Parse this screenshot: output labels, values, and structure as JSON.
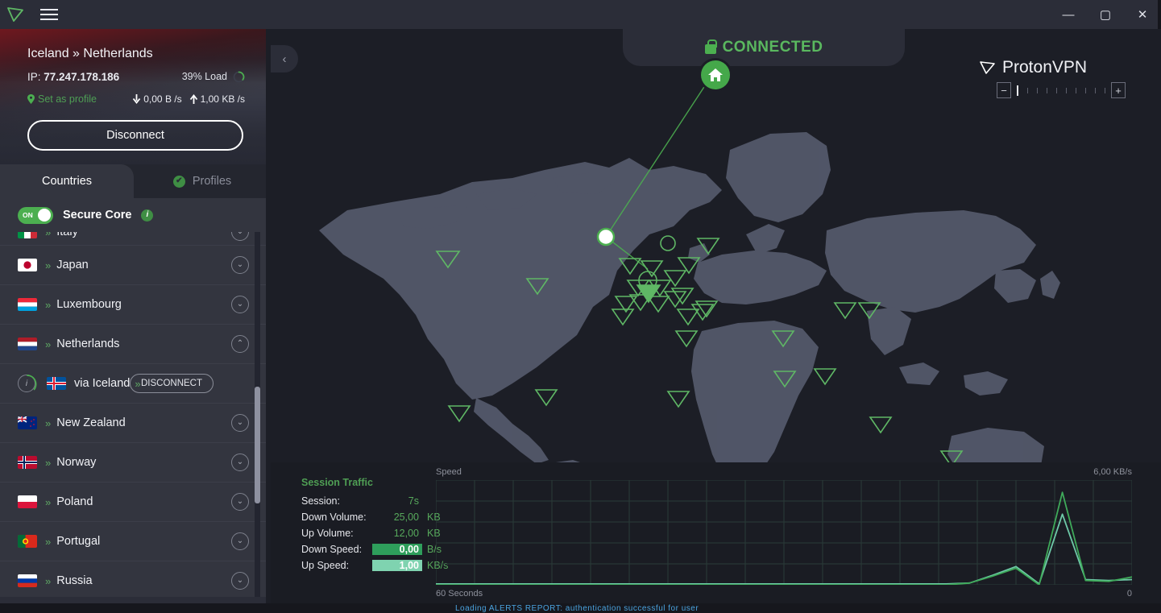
{
  "titlebar": {
    "logo_icon": "protonvpn-logo-icon",
    "menu_icon": "hamburger-menu-icon",
    "minimize": "—",
    "maximize": "▢",
    "close": "✕"
  },
  "sidebar": {
    "route": "Iceland » Netherlands",
    "ip_label": "IP:",
    "ip_value": "77.247.178.186",
    "load_text": "39% Load",
    "load_percent": 39,
    "set_as_profile": "Set as profile",
    "down_speed": "0,00 B /s",
    "up_speed": "1,00 KB /s",
    "disconnect_label": "Disconnect",
    "tabs": [
      {
        "label": "Countries",
        "active": true
      },
      {
        "label": "Profiles",
        "active": false
      }
    ],
    "secure_core": {
      "toggle_state": "ON",
      "label": "Secure Core"
    },
    "countries": [
      {
        "name": "Italy",
        "partial": true,
        "expanded": false,
        "flag": "it"
      },
      {
        "name": "Japan",
        "partial": false,
        "expanded": false,
        "flag": "jp"
      },
      {
        "name": "Luxembourg",
        "partial": false,
        "expanded": false,
        "flag": "lu"
      },
      {
        "name": "Netherlands",
        "partial": false,
        "expanded": true,
        "flag": "nl"
      },
      {
        "name": "New Zealand",
        "partial": false,
        "expanded": false,
        "flag": "nz"
      },
      {
        "name": "Norway",
        "partial": false,
        "expanded": false,
        "flag": "no"
      },
      {
        "name": "Poland",
        "partial": false,
        "expanded": false,
        "flag": "pl"
      },
      {
        "name": "Portugal",
        "partial": false,
        "expanded": false,
        "flag": "pt"
      },
      {
        "name": "Russia",
        "partial": false,
        "expanded": false,
        "flag": "ru"
      }
    ],
    "subserver": {
      "name": "via Iceland",
      "chevron": "»",
      "info": "i",
      "disconnect_label": "DISCONNECT"
    }
  },
  "map": {
    "collapse_icon": "chevron-left-icon",
    "connected_label": "CONNECTED",
    "lock_icon": "lock-icon",
    "home_icon": "home-icon",
    "brand_name": "ProtonVPN",
    "brand_icon": "protonvpn-logo-icon",
    "zoom_minus": "−",
    "zoom_plus": "+",
    "zoom_level": 1,
    "zoom_ticks": 11
  },
  "session": {
    "title": "Session Traffic",
    "rows": [
      {
        "label": "Session:",
        "value": "7s",
        "unit": "",
        "highlight": "none"
      },
      {
        "label": "Down Volume:",
        "value": "25,00",
        "unit": "KB",
        "highlight": "none"
      },
      {
        "label": "Up Volume:",
        "value": "12,00",
        "unit": "KB",
        "highlight": "none"
      },
      {
        "label": "Down Speed:",
        "value": "0,00",
        "unit": "B/s",
        "highlight": "dark"
      },
      {
        "label": "Up Speed:",
        "value": "1,00",
        "unit": "KB/s",
        "highlight": "light"
      }
    ]
  },
  "chart_data": {
    "type": "line",
    "title": "",
    "ylabel": "Speed",
    "xlabel": "60 Seconds",
    "y_max_label": "6,00  KB/s",
    "y_min_label": "0",
    "ylim": [
      0,
      6
    ],
    "xlim": [
      0,
      60
    ],
    "grid": true,
    "legend": "none",
    "x": [
      0,
      2,
      4,
      6,
      8,
      10,
      12,
      14,
      16,
      18,
      20,
      22,
      24,
      26,
      28,
      30,
      32,
      34,
      36,
      38,
      40,
      42,
      44,
      46,
      48,
      50,
      52,
      54,
      56,
      58,
      60
    ],
    "series": [
      {
        "name": "Down Speed",
        "color": "#6ec9a8",
        "values": [
          0.05,
          0.05,
          0.05,
          0.05,
          0.05,
          0.05,
          0.05,
          0.05,
          0.05,
          0.05,
          0.05,
          0.05,
          0.05,
          0.05,
          0.05,
          0.05,
          0.05,
          0.05,
          0.05,
          0.05,
          0.05,
          0.05,
          0.05,
          0.1,
          0.55,
          1.05,
          0.05,
          4.05,
          0.3,
          0.25,
          0.3
        ]
      },
      {
        "name": "Up Speed",
        "color": "#3faa5a",
        "values": [
          0.0,
          0.0,
          0.0,
          0.0,
          0.0,
          0.0,
          0.0,
          0.0,
          0.0,
          0.0,
          0.0,
          0.0,
          0.0,
          0.0,
          0.0,
          0.0,
          0.0,
          0.0,
          0.0,
          0.0,
          0.0,
          0.0,
          0.0,
          0.1,
          0.5,
          0.95,
          0.0,
          5.3,
          0.25,
          0.2,
          0.45
        ]
      }
    ]
  },
  "statusbar": {
    "text": "Loading  ALERTS REPORT:  authentication  successful  for  user"
  },
  "colors": {
    "accent_green": "#4caf50",
    "panel": "#2b2d38",
    "list_row": "#33353f",
    "map_bg": "#1c1e26",
    "land": "#53586a",
    "marker": "#5fb765"
  }
}
